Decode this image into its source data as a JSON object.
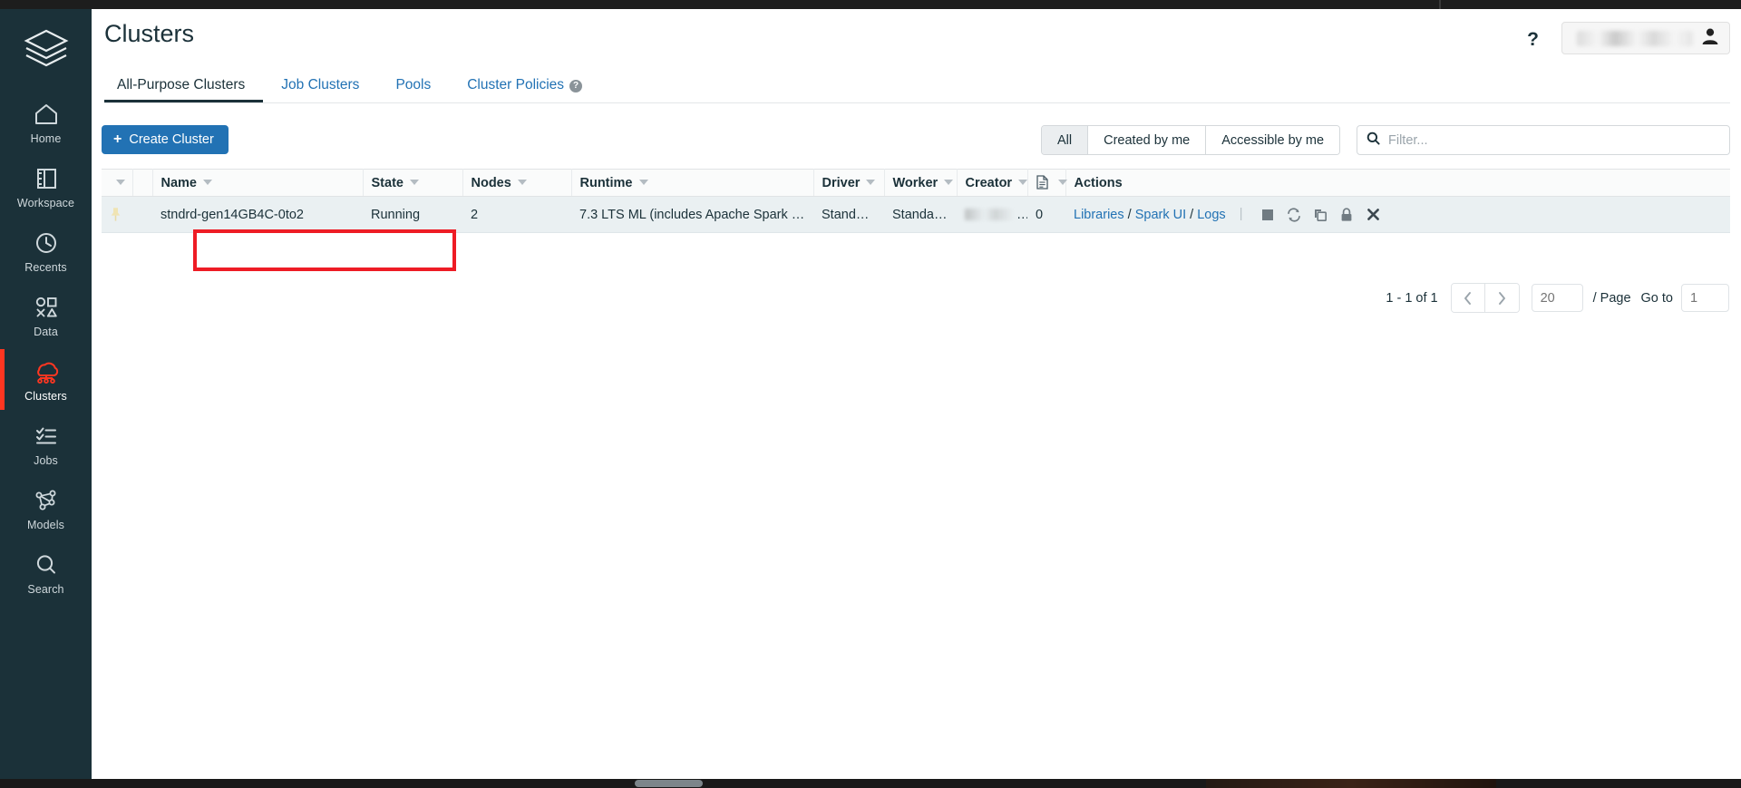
{
  "sidebar": {
    "logo_icon": "databricks-layers-logo",
    "items": [
      {
        "label": "Home",
        "icon": "home-icon",
        "active": false
      },
      {
        "label": "Workspace",
        "icon": "workspace-icon",
        "active": false
      },
      {
        "label": "Recents",
        "icon": "clock-icon",
        "active": false
      },
      {
        "label": "Data",
        "icon": "shapes-icon",
        "active": false
      },
      {
        "label": "Clusters",
        "icon": "clusters-icon",
        "active": true
      },
      {
        "label": "Jobs",
        "icon": "checklist-icon",
        "active": false
      },
      {
        "label": "Models",
        "icon": "models-graph-icon",
        "active": false
      },
      {
        "label": "Search",
        "icon": "search-icon",
        "active": false
      }
    ],
    "active_accent_color": "#ff3621",
    "background_color": "#1b3139"
  },
  "header": {
    "title": "Clusters",
    "help_icon": "question-mark-icon",
    "user_icon": "user-avatar-icon",
    "user_name_redacted": true
  },
  "tabs": [
    {
      "label": "All-Purpose Clusters",
      "active": true,
      "has_help": false
    },
    {
      "label": "Job Clusters",
      "active": false,
      "has_help": false
    },
    {
      "label": "Pools",
      "active": false,
      "has_help": false
    },
    {
      "label": "Cluster Policies",
      "active": false,
      "has_help": true,
      "help_glyph": "?"
    }
  ],
  "toolbar": {
    "create_cluster_label": "Create Cluster",
    "create_cluster_icon": "plus-icon",
    "create_cluster_color": "#2272b4",
    "segments": [
      {
        "label": "All",
        "selected": true
      },
      {
        "label": "Created by me",
        "selected": false
      },
      {
        "label": "Accessible by me",
        "selected": false
      }
    ],
    "filter": {
      "icon": "search-icon",
      "placeholder": "Filter...",
      "value": ""
    }
  },
  "table": {
    "columns": [
      {
        "label": "",
        "sortable": true,
        "icon": ""
      },
      {
        "label": "",
        "sortable": false,
        "icon": ""
      },
      {
        "label": "Name",
        "sortable": true,
        "icon": ""
      },
      {
        "label": "State",
        "sortable": true,
        "icon": ""
      },
      {
        "label": "Nodes",
        "sortable": true,
        "icon": ""
      },
      {
        "label": "Runtime",
        "sortable": true,
        "icon": ""
      },
      {
        "label": "Driver",
        "sortable": true,
        "icon": ""
      },
      {
        "label": "Worker",
        "sortable": true,
        "icon": ""
      },
      {
        "label": "Creator",
        "sortable": true,
        "icon": ""
      },
      {
        "label": "",
        "sortable": true,
        "icon": "notebook-icon"
      },
      {
        "label": "Actions",
        "sortable": false,
        "icon": ""
      }
    ],
    "rows": [
      {
        "pinned": true,
        "pin_icon": "pin-icon",
        "status_icon": "green-status-dot",
        "status_color": "#00a972",
        "name": "stndrd-gen14GB4C-0to2",
        "state": "Running",
        "nodes": "2",
        "runtime": "7.3 LTS ML (includes Apache Spark 3....",
        "driver": "Standar…",
        "worker": "Standar…",
        "creator_redacted": true,
        "creator_suffix": "…",
        "notebooks": "0",
        "actions": {
          "links": [
            {
              "label": "Libraries"
            },
            {
              "label": "Spark UI"
            },
            {
              "label": "Logs"
            }
          ],
          "link_separator": "/",
          "icons": [
            {
              "name": "terminate-square-icon"
            },
            {
              "name": "restart-refresh-icon"
            },
            {
              "name": "clone-copy-icon"
            },
            {
              "name": "permissions-lock-icon"
            },
            {
              "name": "delete-x-icon"
            }
          ]
        },
        "highlighted": true,
        "highlight_color": "#ee1c25"
      }
    ]
  },
  "pagination": {
    "range_text": "1 - 1 of 1",
    "prev_icon": "chevron-left-icon",
    "next_icon": "chevron-right-icon",
    "page_size_value": "20",
    "page_size_placeholder": "20",
    "per_page_label": "/ Page",
    "goto_label": "Go to",
    "goto_value": "1",
    "goto_placeholder": "1"
  }
}
